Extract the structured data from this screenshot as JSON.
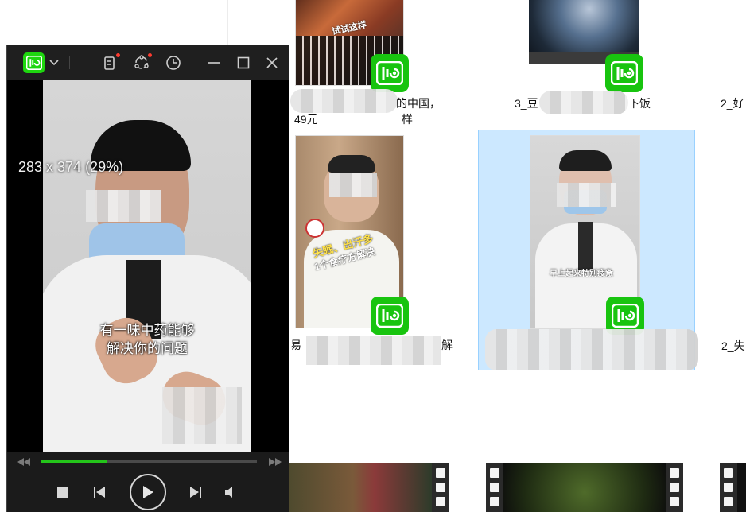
{
  "player": {
    "resolution_text": "283 x 374 (29%)",
    "subtitle_line1": "有一味中药能够",
    "subtitle_line2": "解决你的问题",
    "progress": 0.31,
    "accent_color": "#1ed60f",
    "icons": [
      "app-logo-icon",
      "dropdown-icon",
      "playlist-icon",
      "screen-share-icon",
      "history-icon",
      "minimize-icon",
      "maximize-icon",
      "close-icon",
      "rewind-icon",
      "fast-forward-icon",
      "stop-icon",
      "previous-icon",
      "play-icon",
      "next-icon",
      "volume-icon"
    ]
  },
  "explorer": {
    "files": [
      {
        "name_visible_prefix": "",
        "name_visible_suffix": "的中国，",
        "name_line2_prefix": "49元",
        "name_line2_suffix": "样",
        "overlay": "试试这样"
      },
      {
        "name_visible_prefix": "3_豆",
        "name_visible_suffix": "下饭",
        "overlay": ""
      },
      {
        "name_visible_prefix": "2_好",
        "name_visible_suffix": "",
        "overlay": ""
      },
      {
        "name_visible_prefix": "易",
        "name_visible_suffix": "解",
        "overlay_line1": "失眠、出汗多",
        "overlay_line2": "1个食疗方解决"
      },
      {
        "name_visible_prefix": "",
        "name_visible_suffix": "",
        "overlay": "早上起来特别疲惫"
      },
      {
        "name_visible_prefix": "2_失",
        "name_visible_suffix": "",
        "overlay": ""
      }
    ],
    "selection_color": "#cce8ff"
  }
}
